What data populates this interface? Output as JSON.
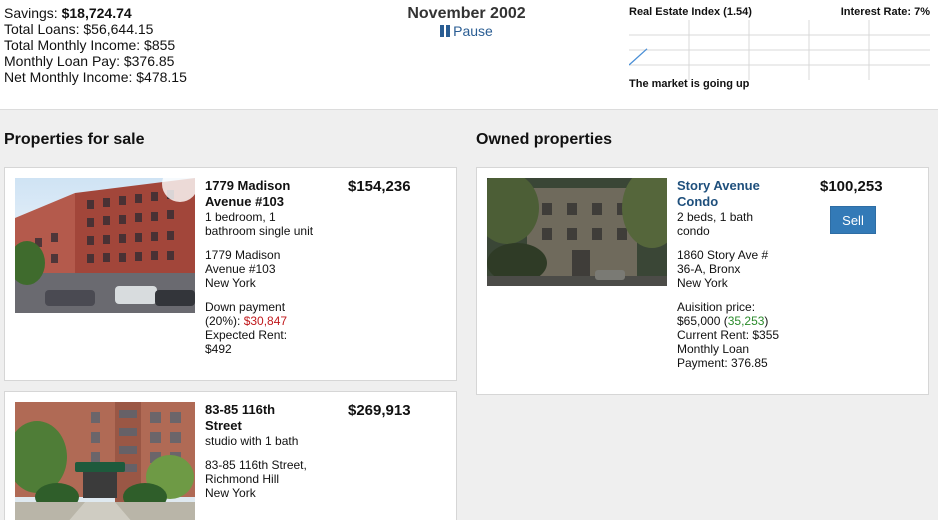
{
  "stats": {
    "savings_label": "Savings:",
    "savings_value": "$18,724.74",
    "total_loans": "Total Loans: $56,644.15",
    "total_monthly_income": "Total Monthly Income: $855",
    "monthly_loan_pay": "Monthly Loan Pay: $376.85",
    "net_monthly_income": "Net Monthly Income: $478.15"
  },
  "clock": {
    "date": "November 2002",
    "pause_label": "Pause"
  },
  "market": {
    "index_label": "Real Estate Index (",
    "index_value": "1.54",
    "index_close": ")",
    "interest_rate": "Interest Rate: 7%",
    "status": "The market is going up"
  },
  "chart_data": {
    "type": "line",
    "series": [
      {
        "values": [
          1.0,
          1.54
        ]
      }
    ],
    "grid": true,
    "line_color": "#4a8fd6"
  },
  "sections": {
    "for_sale": "Properties for sale",
    "owned": "Owned properties"
  },
  "for_sale": [
    {
      "title": "1779 Madison Avenue #103",
      "description": "1 bedroom, 1 bathroom single unit",
      "address_line1": "1779 Madison Avenue #103",
      "address_line2": "New York",
      "down_payment_label": "Down payment (20%): ",
      "down_payment_value": "$30,847",
      "expected_rent": "Expected Rent: $492",
      "price": "$154,236"
    },
    {
      "title": "83-85 116th Street",
      "description": "studio with 1 bath",
      "address_line1": "83-85 116th Street, Richmond Hill",
      "address_line2": "New York",
      "price": "$269,913"
    }
  ],
  "owned": [
    {
      "title": "Story Avenue Condo",
      "description": "2 beds, 1 bath condo",
      "address_line1": "1860 Story Ave # 36-A, Bronx",
      "address_line2": "New York",
      "acquisition_label": "Auisition price: $65,000 (",
      "acquisition_gain": "35,253",
      "acquisition_close": ")",
      "current_rent": "Current Rent: $355",
      "monthly_loan_payment": "Monthly Loan Payment: 376.85",
      "price": "$100,253",
      "sell_label": "Sell"
    }
  ]
}
